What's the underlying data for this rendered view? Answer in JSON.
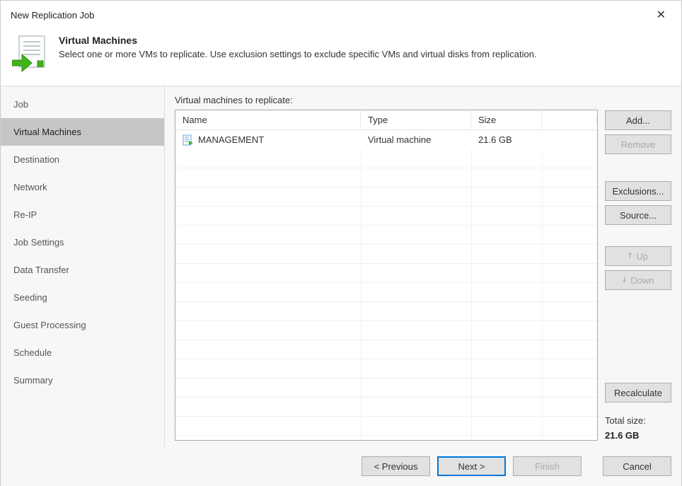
{
  "window": {
    "title": "New Replication Job"
  },
  "header": {
    "title": "Virtual Machines",
    "subtitle": "Select one or more VMs to replicate. Use exclusion settings to exclude specific VMs and virtual disks from replication."
  },
  "sidebar": {
    "items": [
      {
        "label": "Job"
      },
      {
        "label": "Virtual Machines"
      },
      {
        "label": "Destination"
      },
      {
        "label": "Network"
      },
      {
        "label": "Re-IP"
      },
      {
        "label": "Job Settings"
      },
      {
        "label": "Data Transfer"
      },
      {
        "label": "Seeding"
      },
      {
        "label": "Guest Processing"
      },
      {
        "label": "Schedule"
      },
      {
        "label": "Summary"
      }
    ],
    "active_index": 1
  },
  "main": {
    "table_label": "Virtual machines to replicate:",
    "columns": {
      "name": "Name",
      "type": "Type",
      "size": "Size"
    },
    "rows": [
      {
        "name": "MANAGEMENT",
        "type": "Virtual machine",
        "size": "21.6 GB"
      }
    ]
  },
  "buttons": {
    "add": "Add...",
    "remove": "Remove",
    "exclusions": "Exclusions...",
    "source": "Source...",
    "up": "Up",
    "down": "Down",
    "recalculate": "Recalculate"
  },
  "summary": {
    "total_label": "Total size:",
    "total_value": "21.6 GB"
  },
  "footer": {
    "previous": "< Previous",
    "next": "Next >",
    "finish": "Finish",
    "cancel": "Cancel"
  }
}
